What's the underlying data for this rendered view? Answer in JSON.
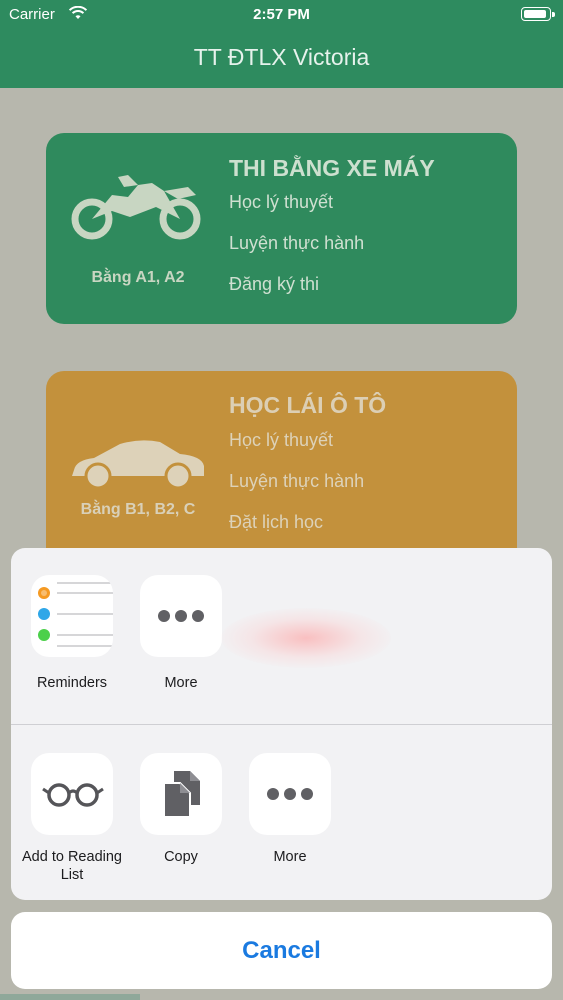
{
  "status_bar": {
    "carrier": "Carrier",
    "time": "2:57 PM"
  },
  "nav": {
    "title": "TT ĐTLX Victoria"
  },
  "cards": {
    "moto": {
      "title": "THI BẰNG XE MÁY",
      "license": "Bằng A1, A2",
      "items": [
        "Học lý thuyết",
        "Luyện thực hành",
        "Đăng ký thi"
      ],
      "icon": "motorcycle-icon"
    },
    "car": {
      "title": "HỌC LÁI Ô TÔ",
      "license": "Bằng B1, B2, C",
      "items": [
        "Học lý thuyết",
        "Luyện thực hành",
        "Đặt lịch học"
      ],
      "icon": "car-icon"
    }
  },
  "share_sheet": {
    "apps": [
      {
        "label": "Reminders",
        "icon": "reminders-icon"
      },
      {
        "label": "More",
        "icon": "more-dots-icon"
      }
    ],
    "actions": [
      {
        "label": "Add to Reading List",
        "icon": "glasses-icon"
      },
      {
        "label": "Copy",
        "icon": "copy-icon"
      },
      {
        "label": "More",
        "icon": "more-dots-icon"
      }
    ],
    "cancel_label": "Cancel"
  },
  "colors": {
    "nav_green": "#2e8b5f",
    "card_moto": "#2f8a5d",
    "card_car": "#c3913c",
    "cancel_blue": "#1a7ae0"
  }
}
